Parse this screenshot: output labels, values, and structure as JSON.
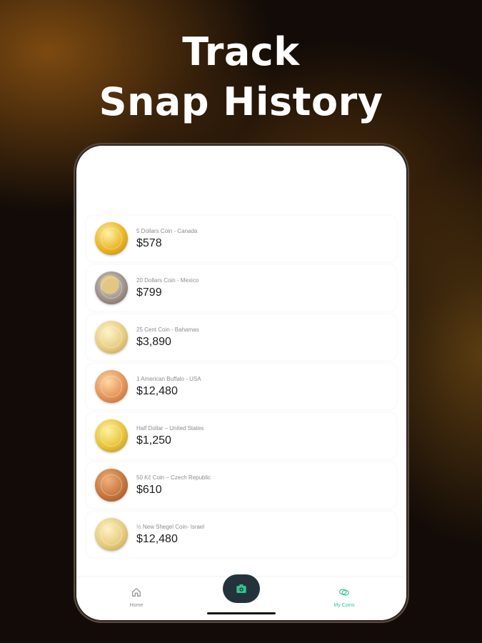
{
  "headline": {
    "line1": "Track",
    "line2": "Snap History"
  },
  "coins": [
    {
      "name": "5 Dollars Coin - Canada",
      "price": "$578"
    },
    {
      "name": "20 Dollars Coin - Mexico",
      "price": "$799"
    },
    {
      "name": "25 Cent Coin - Bahamas",
      "price": "$3,890"
    },
    {
      "name": "1 American Buffalo - USA",
      "price": "$12,480"
    },
    {
      "name": "Half Dollar – United States",
      "price": "$1,250"
    },
    {
      "name": "50 Kč Coin – Czech Republic",
      "price": "$610"
    },
    {
      "name": "½ New Shegel Coin- Israel",
      "price": "$12,480"
    }
  ],
  "nav": {
    "home_label": "Home",
    "my_coins_label": "My Coins"
  },
  "colors": {
    "accent": "#31c48d",
    "camera_button": "#24333b"
  },
  "icons": {
    "home": "home-icon",
    "camera": "camera-icon",
    "coins": "coins-icon"
  }
}
